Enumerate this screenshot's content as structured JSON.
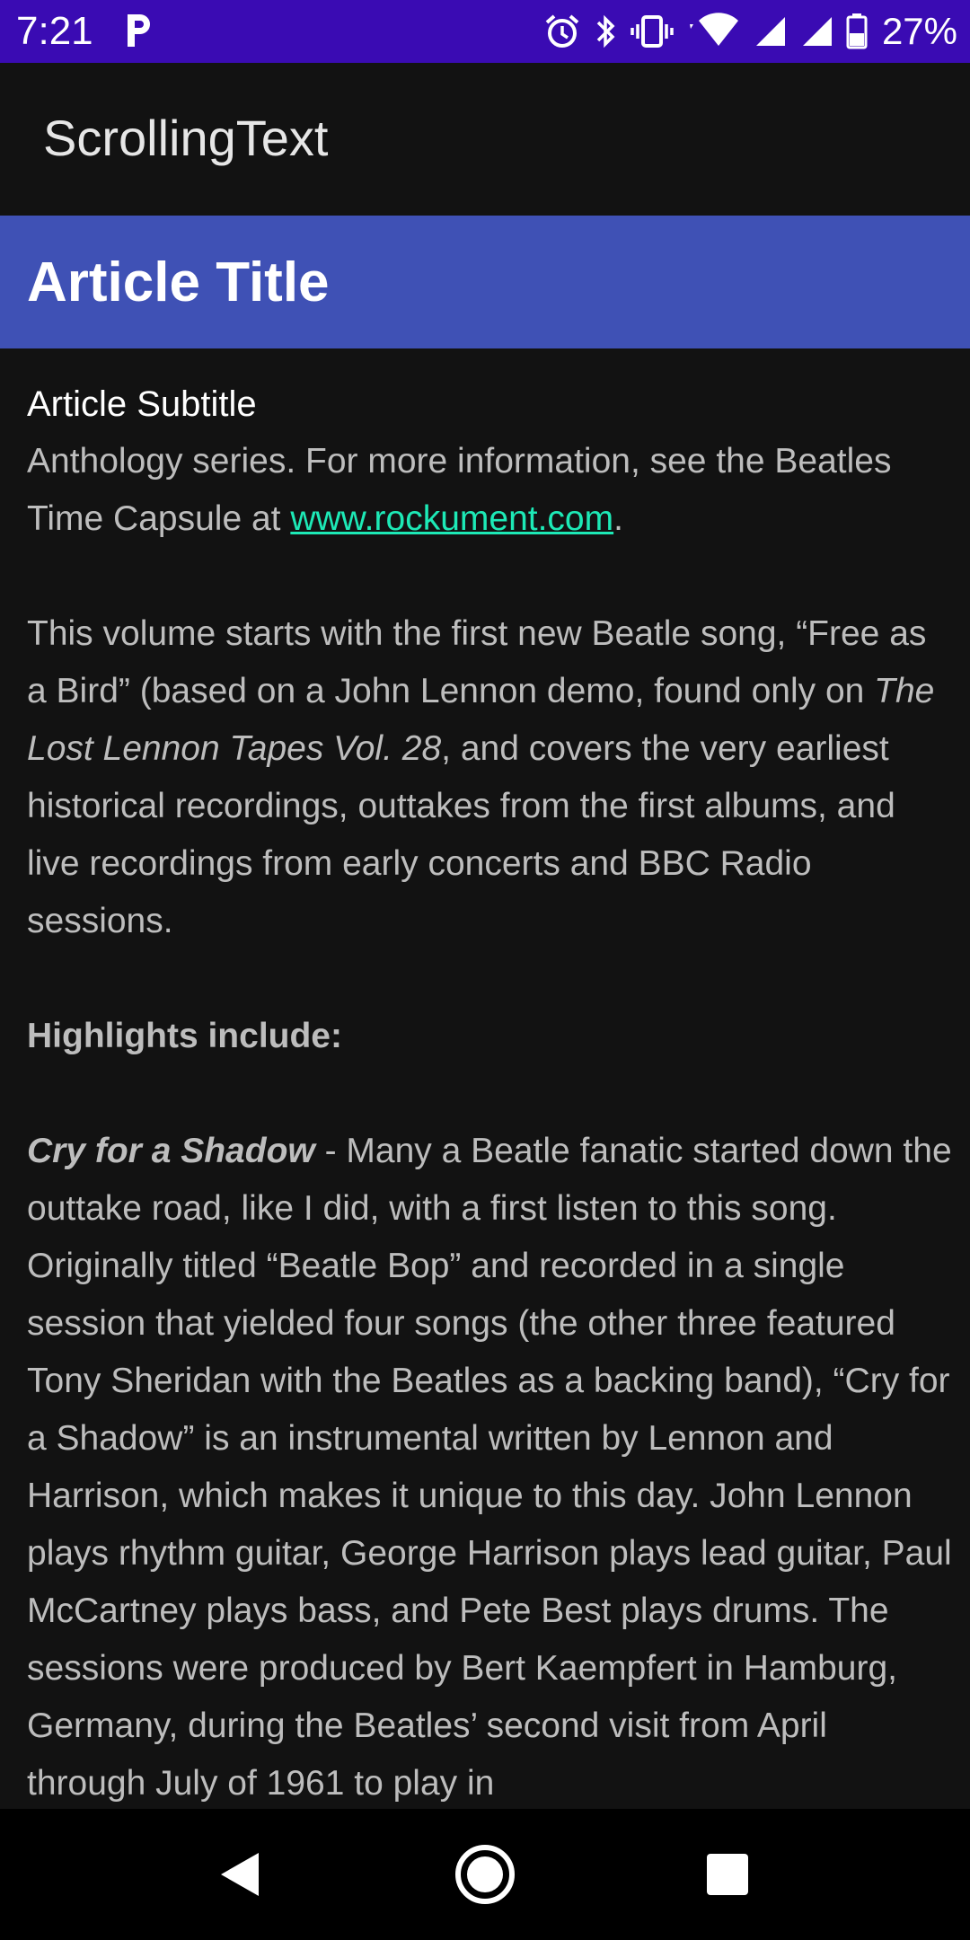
{
  "status_bar": {
    "time": "7:21",
    "battery": "27%",
    "icons": [
      "p-icon",
      "alarm-icon",
      "bluetooth-icon",
      "vibrate-icon",
      "wifi-icon",
      "signal-icon",
      "signal-icon-2",
      "battery-icon"
    ]
  },
  "app_bar": {
    "title": "ScrollingText"
  },
  "article": {
    "title": "Article Title",
    "subtitle": "Article Subtitle",
    "p1_text": "Anthology series. For more information, see the Beatles Time Capsule at ",
    "p1_link": "www.rockument.com",
    "p1_end": ".",
    "p2_start": " This volume starts with the first new Beatle song, “Free as a Bird” (based on a John Lennon demo, found only on ",
    "p2_italic": "The Lost Lennon Tapes Vol. 28",
    "p2_end": ", and covers the very earliest historical recordings, outtakes from the first albums, and live recordings from early concerts and BBC Radio sessions.",
    "highlights_heading": " Highlights include:",
    "p3_title": " Cry for a Shadow",
    "p3_text": " - Many a Beatle fanatic started down the outtake road, like I did, with a first listen to this song. Originally titled “Beatle Bop” and recorded in a single session that yielded four songs (the other three featured Tony Sheridan with the Beatles as a backing band), “Cry for a Shadow” is an instrumental written by Lennon and Harrison, which makes it unique to this day. John Lennon plays rhythm guitar, George Harrison plays lead guitar, Paul McCartney plays bass, and Pete Best plays drums. The sessions were produced by Bert Kaempfert in Hamburg, Germany, during the Beatles’ second visit from April through July of 1961 to play in"
  },
  "colors": {
    "status_bar": "#3a0bb3",
    "header": "#3f51b5",
    "background": "#121212",
    "link": "#1de9b6"
  },
  "nav_bar": {
    "icons": [
      "back-icon",
      "home-icon",
      "recents-icon"
    ]
  }
}
